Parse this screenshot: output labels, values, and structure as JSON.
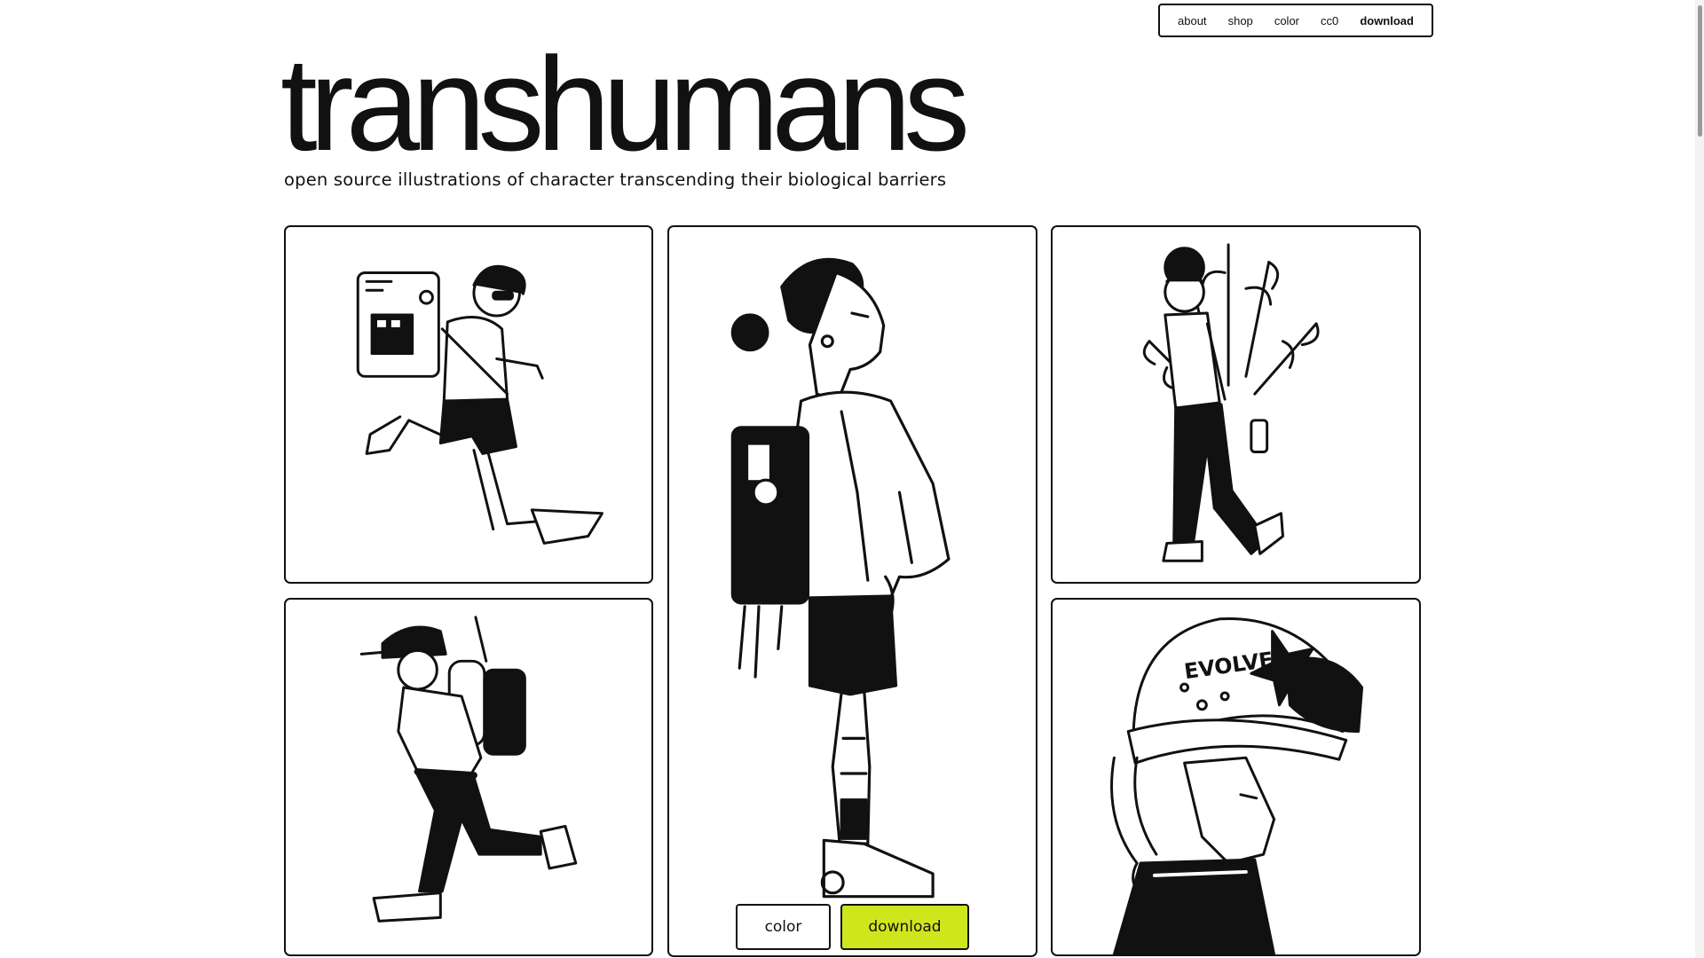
{
  "nav": {
    "items": [
      "about",
      "shop",
      "color",
      "cc0",
      "download"
    ]
  },
  "header": {
    "title": "transhumans",
    "subtitle": "open source illustrations of character transcending their biological barriers"
  },
  "illustrations": {
    "helmet_text": "EVOLVE"
  },
  "actions": {
    "color_label": "color",
    "download_label": "download"
  },
  "colors": {
    "accent": "#cfe61c",
    "ink": "#111111",
    "background": "#ffffff"
  }
}
